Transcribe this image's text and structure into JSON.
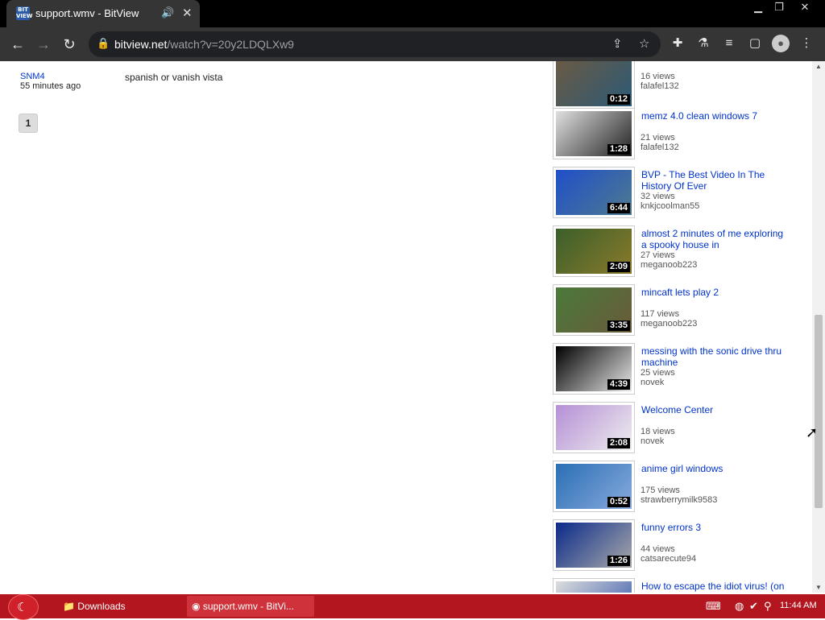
{
  "browser": {
    "tab_title": "support.wmv - BitView",
    "favicon_text": "BIT VIEW",
    "audio_icon": "speaker-icon",
    "close_icon": "close-icon",
    "window_controls": [
      "minimize",
      "restore",
      "close"
    ],
    "url_host": "bitview.net",
    "url_path": "/watch?v=20y2LDQLXw9"
  },
  "comment": {
    "user": "SNM4",
    "time": "55 minutes ago",
    "text": "spanish or vanish vista"
  },
  "pager": {
    "current": "1"
  },
  "related": [
    {
      "title": "",
      "duration": "0:12",
      "views": "16 views",
      "user": "falafel132",
      "colors": [
        "#6a5a44",
        "#2b5a77"
      ]
    },
    {
      "title": "memz 4.0 clean windows 7",
      "duration": "1:28",
      "views": "21 views",
      "user": "falafel132",
      "colors": [
        "#e0e0e0",
        "#222222"
      ]
    },
    {
      "title": "BVP - The Best Video In The History Of Ever",
      "duration": "6:44",
      "views": "32 views",
      "user": "knkjcoolman55",
      "colors": [
        "#1f4fc9",
        "#4f7a8f"
      ]
    },
    {
      "title": "almost 2 minutes of me exploring a spooky house in",
      "duration": "2:09",
      "views": "27 views",
      "user": "meganoob223",
      "colors": [
        "#3a5f2a",
        "#8a7a2a"
      ]
    },
    {
      "title": "mincaft lets play 2",
      "duration": "3:35",
      "views": "117 views",
      "user": "meganoob223",
      "colors": [
        "#4a7a3a",
        "#6a5a3a"
      ]
    },
    {
      "title": "messing with the sonic drive thru machine",
      "duration": "4:39",
      "views": "25 views",
      "user": "novek",
      "colors": [
        "#000000",
        "#e8e8e8"
      ]
    },
    {
      "title": "Welcome Center",
      "duration": "2:08",
      "views": "18 views",
      "user": "novek",
      "colors": [
        "#b58fd6",
        "#eeeeee"
      ]
    },
    {
      "title": "anime girl windows",
      "duration": "0:52",
      "views": "175 views",
      "user": "strawberrymilk9583",
      "colors": [
        "#2a6fb5",
        "#88aadd"
      ]
    },
    {
      "title": "funny errors 3",
      "duration": "1:26",
      "views": "44 views",
      "user": "catsarecute94",
      "colors": [
        "#0a2a8a",
        "#aaaaaa"
      ]
    },
    {
      "title": "How to escape the idiot virus! (on mozilla firefox)",
      "duration": "",
      "views": "",
      "user": "",
      "colors": [
        "#dddddd",
        "#3355aa"
      ]
    }
  ],
  "taskbar": {
    "downloads_label": "Downloads",
    "active_window_label": "support.wmv - BitVi...",
    "clock": "11:44 AM"
  }
}
